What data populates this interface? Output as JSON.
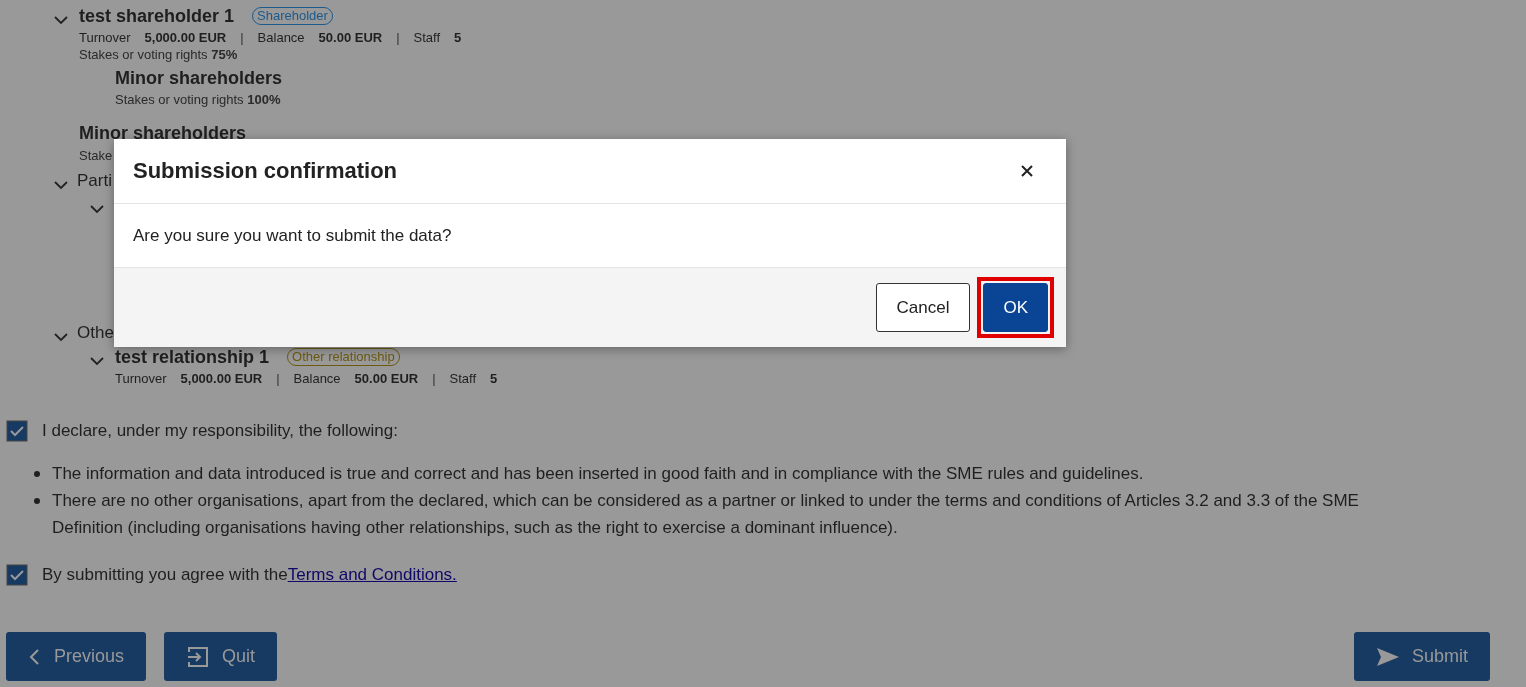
{
  "tree": [
    {
      "kind": "entity",
      "expanded": true,
      "title": "test shareholder 1",
      "tag": {
        "label": "Shareholder",
        "color": "#1d5a8c"
      },
      "metrics": [
        {
          "label": "Turnover",
          "value": "5,000.00 EUR",
          "separator": "|"
        },
        {
          "label": "Balance",
          "value": "50.00 EUR",
          "separator": "|"
        },
        {
          "label": "Staff",
          "value": "5"
        }
      ],
      "stakes": "Stakes or voting rights **75%**",
      "children": [
        {
          "kind": "minor",
          "title": "Minor shareholders",
          "stakes": "Stakes or voting rights **100%**"
        }
      ]
    },
    {
      "kind": "minor",
      "title": "Minor shareholders",
      "stakes": "Stake"
    },
    {
      "kind": "group",
      "expanded": true,
      "title": "Parti",
      "children": [
        {
          "kind": "entity",
          "expanded": true
        }
      ]
    },
    {
      "kind": "group",
      "expanded": true,
      "title": "Othe",
      "children": [
        {
          "kind": "entity",
          "expanded": true,
          "title": "test relationship 1",
          "tag": {
            "label": "Other relationship",
            "color": "#6b5a10"
          },
          "metrics": [
            {
              "label": "Turnover",
              "value": "5,000.00 EUR",
              "separator": "|"
            },
            {
              "label": "Balance",
              "value": "50.00 EUR",
              "separator": "|"
            },
            {
              "label": "Staff",
              "value": "5"
            }
          ]
        }
      ]
    }
  ],
  "declarations": [
    {
      "kind": "checkbox",
      "checked": true,
      "label": "I declare, under my responsibility, the following:"
    },
    {
      "kind": "bullets",
      "items": [
        "The information and data introduced is true and correct and has been inserted in good faith and in compliance with the SME rules and guidelines.",
        "There are no other organisations, apart from the declared, which can be considered as a partner or linked to under the terms and conditions of Articles 3.2 and 3.3 of the SME Definition (including organisations having other relationships, such as the right to exercise a dominant influence)."
      ]
    },
    {
      "kind": "checkbox",
      "checked": true,
      "label": "By submitting you agree with the",
      "link": "Terms and Conditions."
    }
  ],
  "buttons": [
    {
      "kind": "previous",
      "label": "Previous"
    },
    {
      "kind": "quit",
      "label": "Quit"
    },
    {
      "kind": "submit",
      "label": "Submit"
    }
  ],
  "modal": {
    "title": "Submission confirmation",
    "message": "Are you sure you want to submit the data?",
    "buttons": [
      {
        "kind": "secondary",
        "label": "Cancel",
        "highlighted": false
      },
      {
        "kind": "primary",
        "label": "OK",
        "highlighted": true
      }
    ]
  }
}
